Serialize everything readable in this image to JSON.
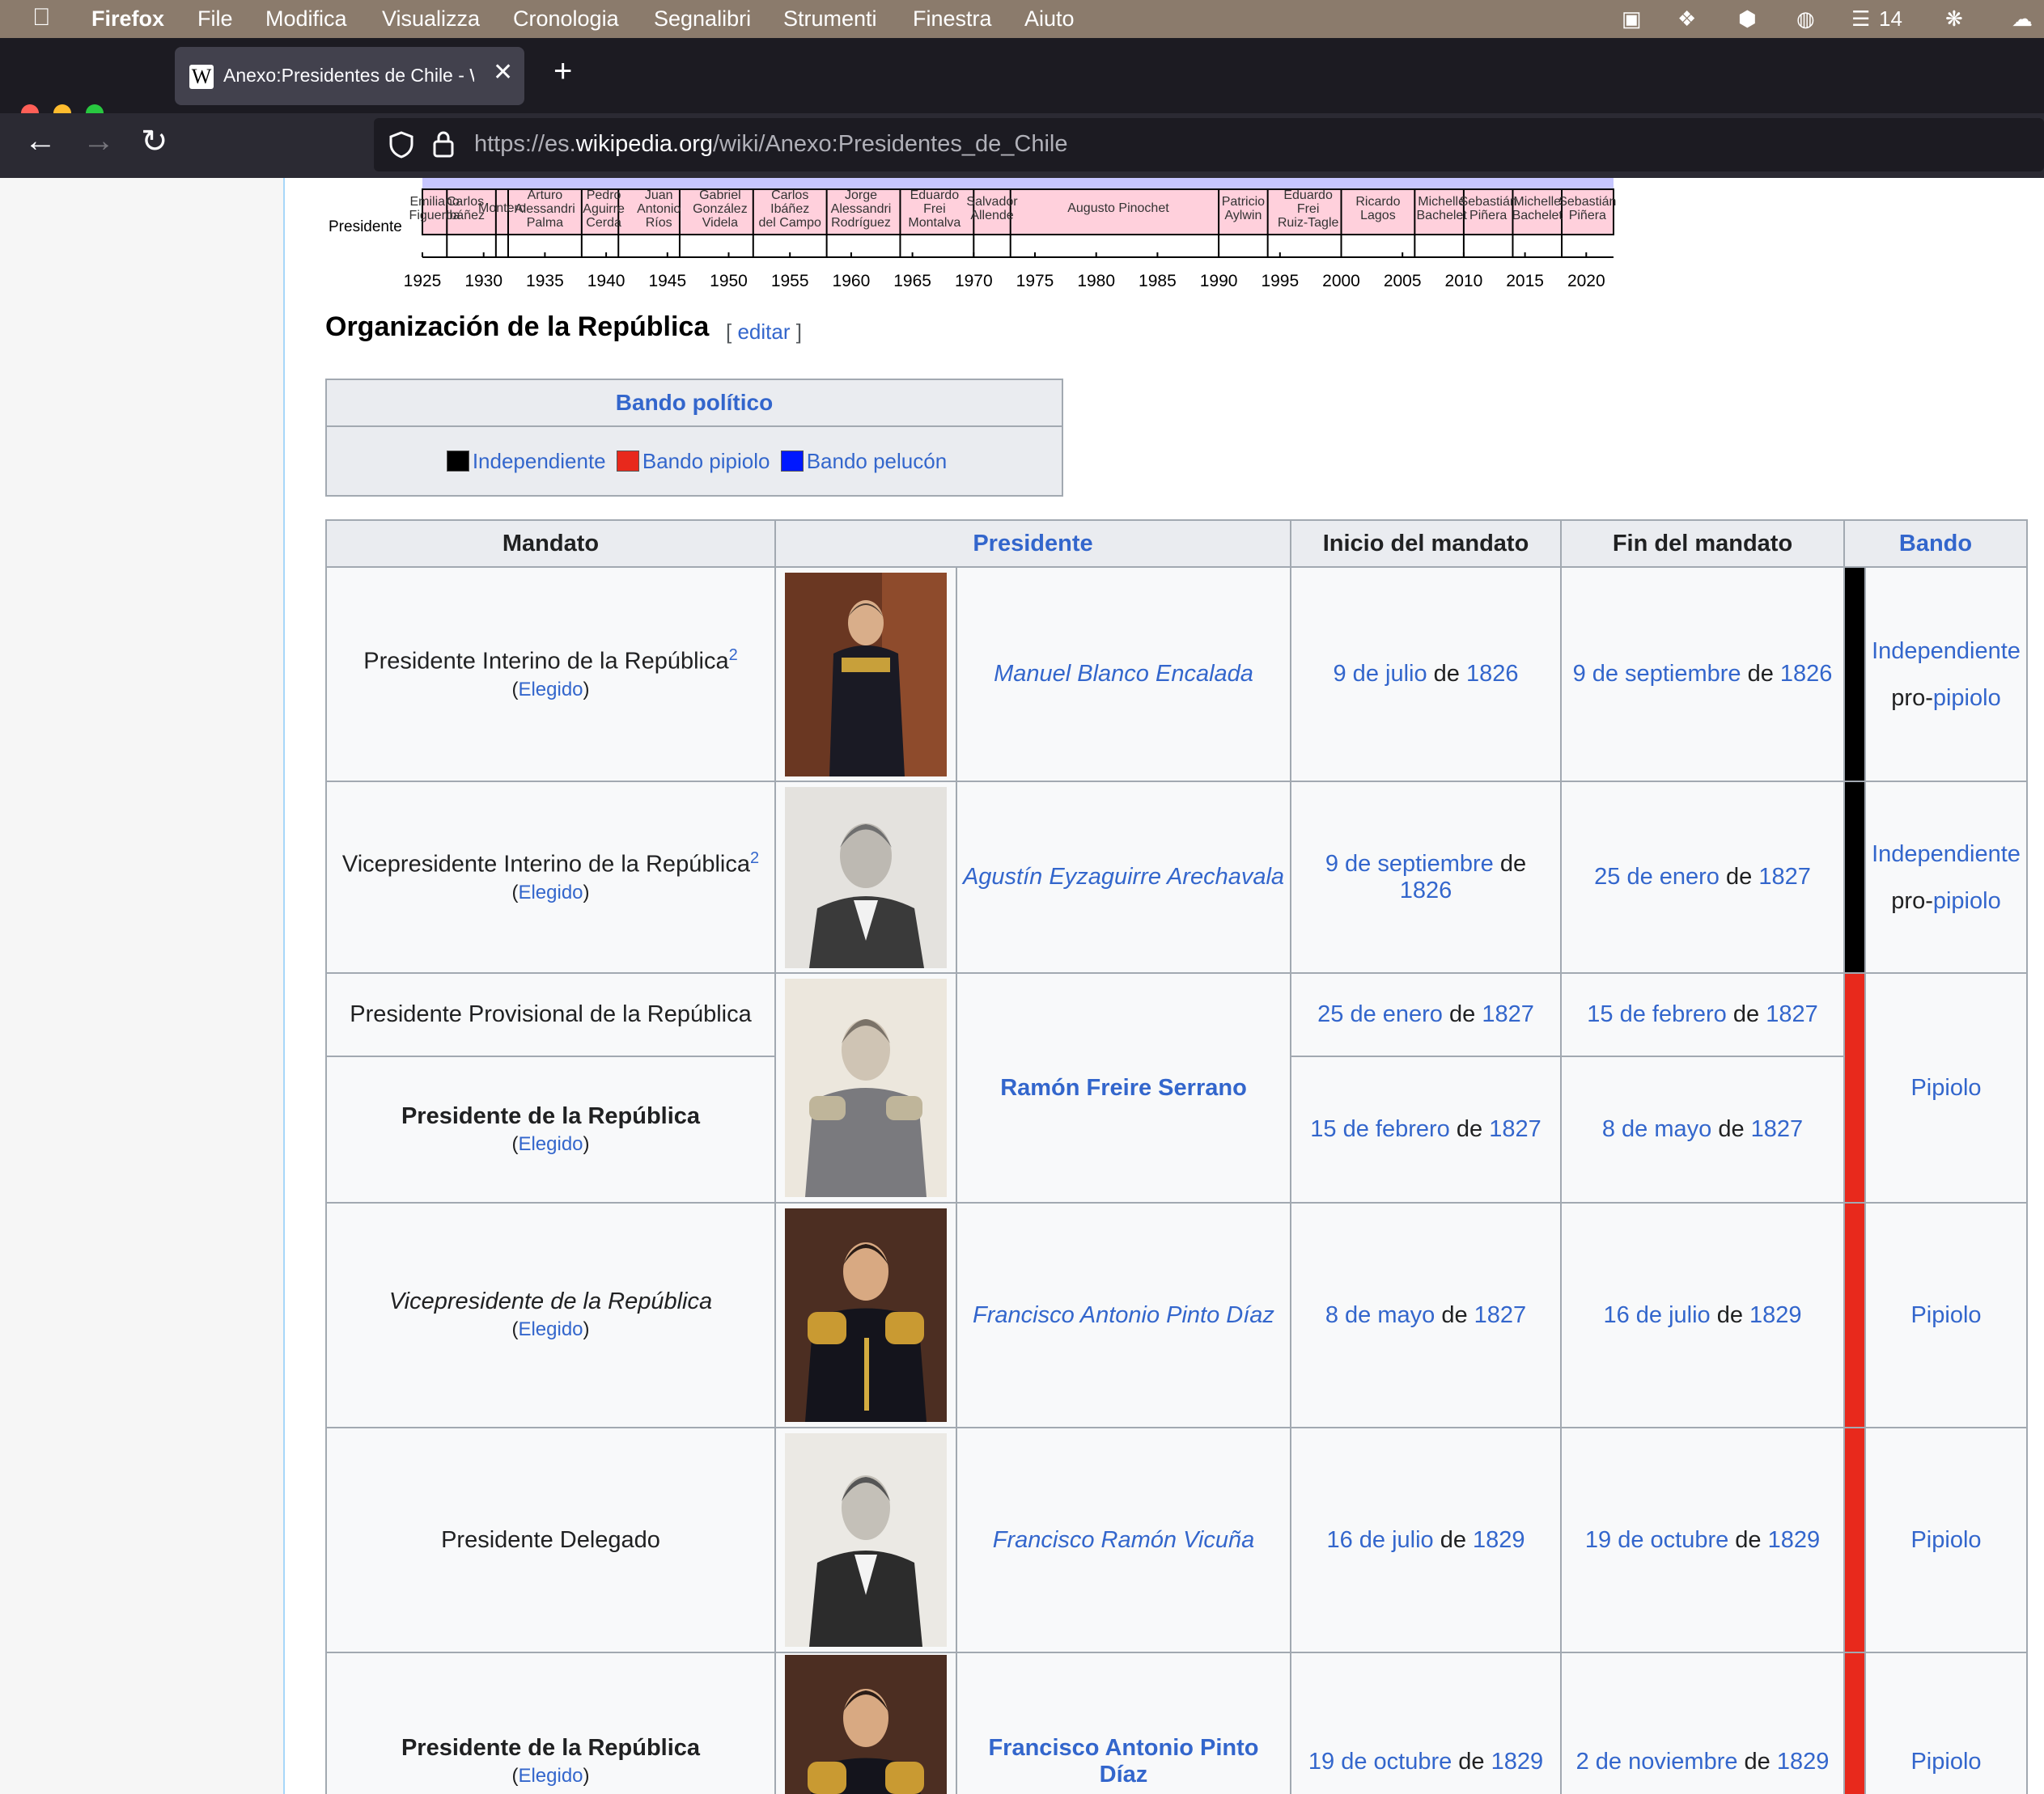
{
  "menubar": {
    "items": [
      "Firefox",
      "File",
      "Modifica",
      "Visualizza",
      "Cronologia",
      "Segnalibri",
      "Strumenti",
      "Finestra",
      "Aiuto"
    ],
    "right_badge": "14"
  },
  "browser": {
    "tab_title": "Anexo:Presidentes de Chile - Wi",
    "url_pre": "https://es.",
    "url_host": "wikipedia.org",
    "url_path": "/wiki/Anexo:Presidentes_de_Chile"
  },
  "timeline": {
    "row_label": "Presidente",
    "years": [
      "1925",
      "1930",
      "1935",
      "1940",
      "1945",
      "1950",
      "1955",
      "1960",
      "1965",
      "1970",
      "1975",
      "1980",
      "1985",
      "1990",
      "1995",
      "2000",
      "2005",
      "2010",
      "2015",
      "2020"
    ],
    "names": [
      {
        "lines": [
          "Emiliano",
          "Figueroa"
        ],
        "yr": 1926
      },
      {
        "lines": [
          "Carlos",
          "Ibáñez"
        ],
        "yr": 1928.5
      },
      {
        "lines": [
          "Montero"
        ],
        "yr": 1931.5
      },
      {
        "lines": [
          "Arturo",
          "Alessandri",
          "Palma"
        ],
        "yr": 1935
      },
      {
        "lines": [
          "Pedro",
          "Aguirre",
          "Cerda"
        ],
        "yr": 1939.8
      },
      {
        "lines": [
          "Juan",
          "Antonio",
          "Ríos"
        ],
        "yr": 1944.3
      },
      {
        "lines": [
          "Gabriel",
          "González",
          "Videla"
        ],
        "yr": 1949.3
      },
      {
        "lines": [
          "Carlos",
          "Ibáñez",
          "del Campo"
        ],
        "yr": 1955
      },
      {
        "lines": [
          "Jorge",
          "Alessandri",
          "Rodríguez"
        ],
        "yr": 1960.8
      },
      {
        "lines": [
          "Eduardo",
          "Frei",
          "Montalva"
        ],
        "yr": 1966.8
      },
      {
        "lines": [
          "Salvador",
          "Allende"
        ],
        "yr": 1971.5
      },
      {
        "lines": [
          "Augusto Pinochet"
        ],
        "yr": 1981.8
      },
      {
        "lines": [
          "Patricio",
          "Aylwin"
        ],
        "yr": 1992
      },
      {
        "lines": [
          "Eduardo",
          "Frei",
          "Ruiz-Tagle"
        ],
        "yr": 1997.3
      },
      {
        "lines": [
          "Ricardo",
          "Lagos"
        ],
        "yr": 2003
      },
      {
        "lines": [
          "Michelle",
          "Bachelet"
        ],
        "yr": 2008.2
      },
      {
        "lines": [
          "Sebastián",
          "Piñera"
        ],
        "yr": 2012
      },
      {
        "lines": [
          "Michelle",
          "Bachelet"
        ],
        "yr": 2016
      },
      {
        "lines": [
          "Sebastián",
          "Piñera"
        ],
        "yr": 2020.1
      }
    ]
  },
  "section": {
    "title": "Organización de la República",
    "edit_open": "[ ",
    "edit_label": "editar",
    "edit_close": " ]"
  },
  "bando_box": {
    "title": "Bando político",
    "legend": [
      {
        "label": "Independiente",
        "color": "#000000"
      },
      {
        "label": "Bando pipiolo",
        "color": "#e8291c"
      },
      {
        "label": "Bando pelucón",
        "color": "#0018ff"
      }
    ]
  },
  "table": {
    "headers": {
      "mandato": "Mandato",
      "presidente": "Presidente",
      "inicio": "Inicio del mandato",
      "fin": "Fin del mandato",
      "bando": "Bando"
    },
    "common": {
      "de": " de ",
      "elegido": "Elegido",
      "open": "(",
      "close": ")",
      "sup": "2",
      "pro": "pro-"
    },
    "rows": [
      {
        "mandato": "Presidente Interino de la República",
        "president": "Manuel Blanco Encalada",
        "inicio": {
          "day": "9 de julio",
          "year": "1826"
        },
        "fin": {
          "day": "9 de septiembre",
          "year": "1826"
        },
        "bando": "Independiente",
        "bando2": "pipiolo",
        "color": "#000000"
      },
      {
        "mandato": "Vicepresidente Interino de la República",
        "president": "Agustín Eyzaguirre Arechavala",
        "inicio": {
          "day": "9 de septiembre",
          "year": "1826"
        },
        "fin": {
          "day": "25 de enero",
          "year": "1827"
        },
        "bando": "Independiente",
        "bando2": "pipiolo",
        "color": "#000000"
      },
      {
        "mandato": "Presidente Provisional de la República",
        "mandato2": "Presidente de la República",
        "president": "Ramón Freire Serrano",
        "inicio": {
          "day": "25 de enero",
          "year": "1827"
        },
        "fin": {
          "day": "15 de febrero",
          "year": "1827"
        },
        "inicio2": {
          "day": "15 de febrero",
          "year": "1827"
        },
        "fin2": {
          "day": "8 de mayo",
          "year": "1827"
        },
        "bando": "Pipiolo",
        "color": "#e8291c"
      },
      {
        "mandato": "Vicepresidente de la República",
        "president": "Francisco Antonio Pinto Díaz",
        "inicio": {
          "day": "8 de mayo",
          "year": "1827"
        },
        "fin": {
          "day": "16 de julio",
          "year": "1829"
        },
        "bando": "Pipiolo",
        "color": "#e8291c"
      },
      {
        "mandato": "Presidente Delegado",
        "president": "Francisco Ramón Vicuña",
        "inicio": {
          "day": "16 de julio",
          "year": "1829"
        },
        "fin": {
          "day": "19 de octubre",
          "year": "1829"
        },
        "bando": "Pipiolo",
        "color": "#e8291c"
      },
      {
        "mandato": "Presidente de la República",
        "president": "Francisco Antonio Pinto Díaz",
        "inicio": {
          "day": "19 de octubre",
          "year": "1829"
        },
        "fin": {
          "day": "2 de noviembre",
          "year": "1829"
        },
        "bando": "Pipiolo",
        "color": "#e8291c"
      }
    ]
  }
}
